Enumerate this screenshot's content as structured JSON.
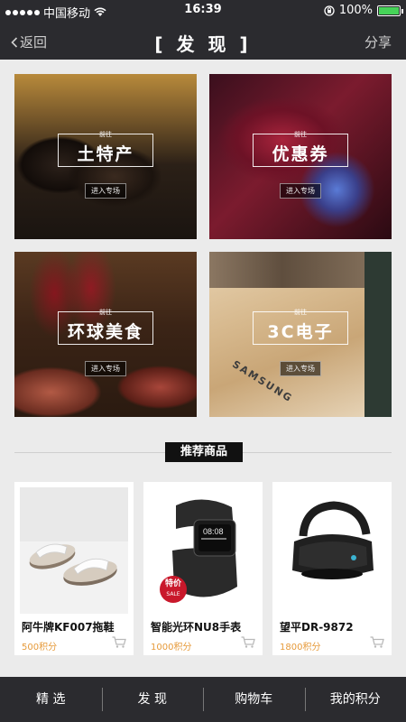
{
  "status_bar": {
    "carrier": "中国移动",
    "time": "16:39",
    "battery": "100%"
  },
  "header": {
    "back_label": "返回",
    "title": "[ 发 现 ]",
    "share_label": "分享"
  },
  "categories": [
    {
      "tag": "前往",
      "name": "土特产",
      "enter": "进入专场"
    },
    {
      "tag": "前往",
      "name": "优惠券",
      "enter": "进入专场"
    },
    {
      "tag": "前往",
      "name": "环球美食",
      "enter": "进入专场"
    },
    {
      "tag": "前往",
      "name": "3C电子",
      "enter": "进入专场"
    }
  ],
  "brand_print": "SAMSUNG",
  "recommend": {
    "title": "推荐商品",
    "products": [
      {
        "name": "阿牛牌KF007拖鞋",
        "price": "500积分"
      },
      {
        "name": "智能光环NU8手表",
        "price": "1000积分",
        "badge": "特价",
        "badge_sub": "SALE",
        "screen_text": "08:08"
      },
      {
        "name": "望平DR-9872",
        "price": "1800积分"
      }
    ]
  },
  "tabbar": [
    {
      "label": "精 选"
    },
    {
      "label": "发 现"
    },
    {
      "label": "购物车"
    },
    {
      "label": "我的积分"
    }
  ],
  "colors": {
    "bar_bg": "#2b2b2f",
    "price": "#e69a3a",
    "battery": "#46d358",
    "sale_badge": "#c9182b"
  }
}
